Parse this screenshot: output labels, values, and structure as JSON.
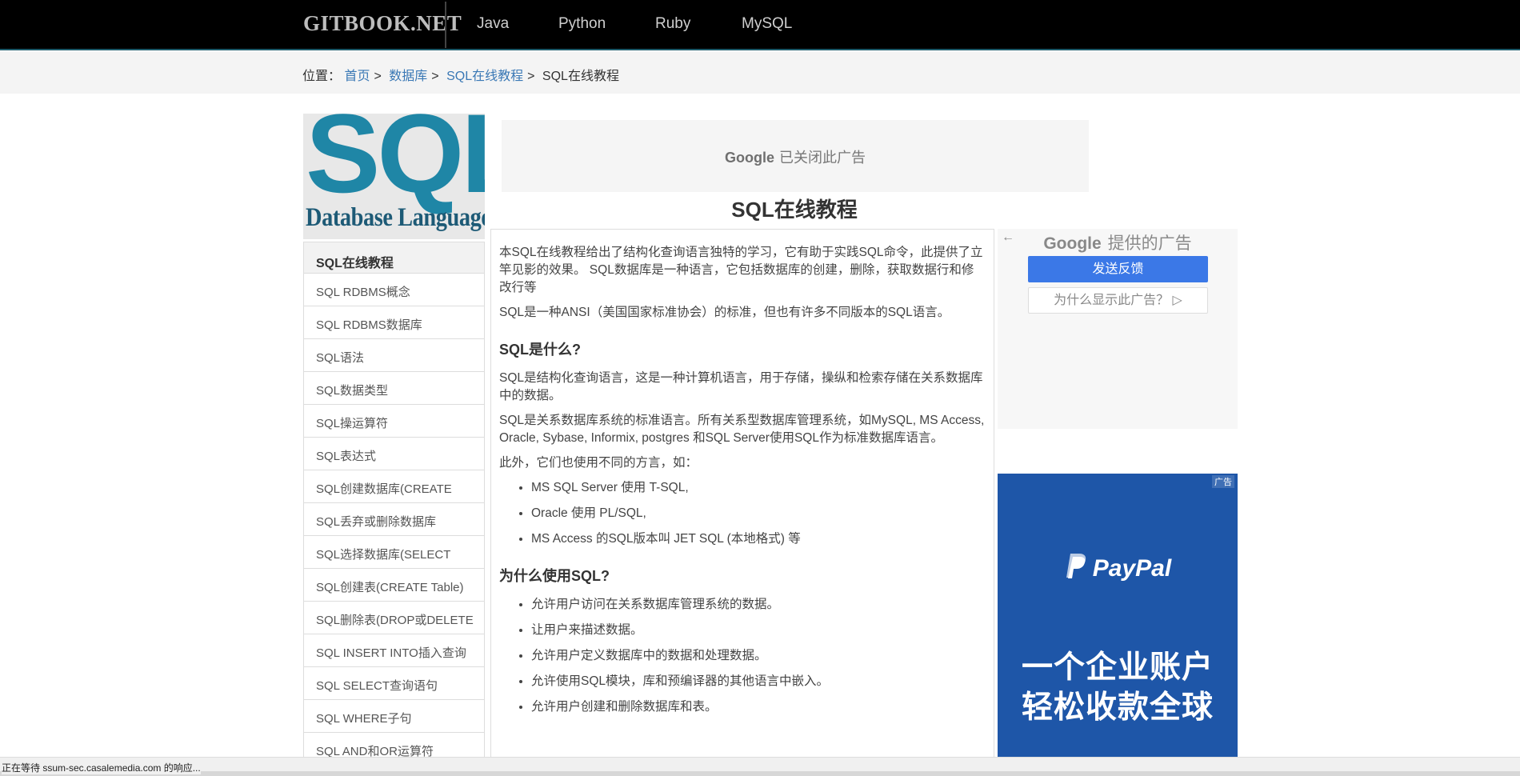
{
  "header": {
    "logo": "GITBOOK.NET",
    "nav": [
      "Java",
      "Python",
      "Ruby",
      "MySQL"
    ]
  },
  "breadcrumb": {
    "prefix": "位置：",
    "links": [
      "首页",
      "数据库",
      "SQL在线教程"
    ],
    "current": "SQL在线教程",
    "separator": ">"
  },
  "logo_image": {
    "big": "SQL",
    "small": "Database Language"
  },
  "sidebar": {
    "head": "SQL在线教程",
    "items": [
      "SQL RDBMS概念",
      "SQL RDBMS数据库",
      "SQL语法",
      "SQL数据类型",
      "SQL操运算符",
      "SQL表达式",
      "SQL创建数据库(CREATE",
      "SQL丢弃或删除数据库",
      "SQL选择数据库(SELECT",
      "SQL创建表(CREATE Table)",
      "SQL删除表(DROP或DELETE",
      "SQL INSERT INTO插入查询",
      "SQL SELECT查询语句",
      "SQL WHERE子句",
      "SQL AND和OR运算符"
    ]
  },
  "ad_top": {
    "google": "Google",
    "text": "已关闭此广告"
  },
  "page_title": "SQL在线教程",
  "article": {
    "intro1": "本SQL在线教程给出了结构化查询语言独特的学习，它有助于实践SQL命令，此提供了立竿见影的效果。 SQL数据库是一种语言，它包括数据库的创建，删除，获取数据行和修改行等",
    "intro2": "SQL是一种ANSI（美国国家标准协会）的标准，但也有许多不同版本的SQL语言。",
    "h1": "SQL是什么?",
    "p1": "SQL是结构化查询语言，这是一种计算机语言，用于存储，操纵和检索存储在关系数据库中的数据。",
    "p2": "SQL是关系数据库系统的标准语言。所有关系型数据库管理系统，如MySQL, MS Access, Oracle, Sybase, Informix, postgres 和SQL Server使用SQL作为标准数据库语言。",
    "p3": "此外，它们也使用不同的方言，如：",
    "dialects": [
      "MS SQL Server 使用 T-SQL,",
      "Oracle 使用 PL/SQL,",
      "MS Access 的SQL版本叫 JET SQL (本地格式) 等"
    ],
    "h2": "为什么使用SQL?",
    "reasons": [
      "允许用户访问在关系数据库管理系统的数据。",
      "让用户来描述数据。",
      "允许用户定义数据库中的数据和处理数据。",
      "允许使用SQL模块，库和预编译器的其他语言中嵌入。",
      "允许用户创建和删除数据库和表。"
    ]
  },
  "ad_right": {
    "back": "←",
    "google": "Google",
    "provided": "提供的广告",
    "feedback": "发送反馈",
    "why": "为什么显示此广告？ ▷"
  },
  "paypal_ad": {
    "tag": "广告",
    "logo": "PayPal",
    "slogan_line1": "一个企业账户",
    "slogan_line2": "轻松收款全球",
    "brand_color": "#1e56a8"
  },
  "status": {
    "text": "正在等待 ssum-sec.casalemedia.com 的响应..."
  }
}
